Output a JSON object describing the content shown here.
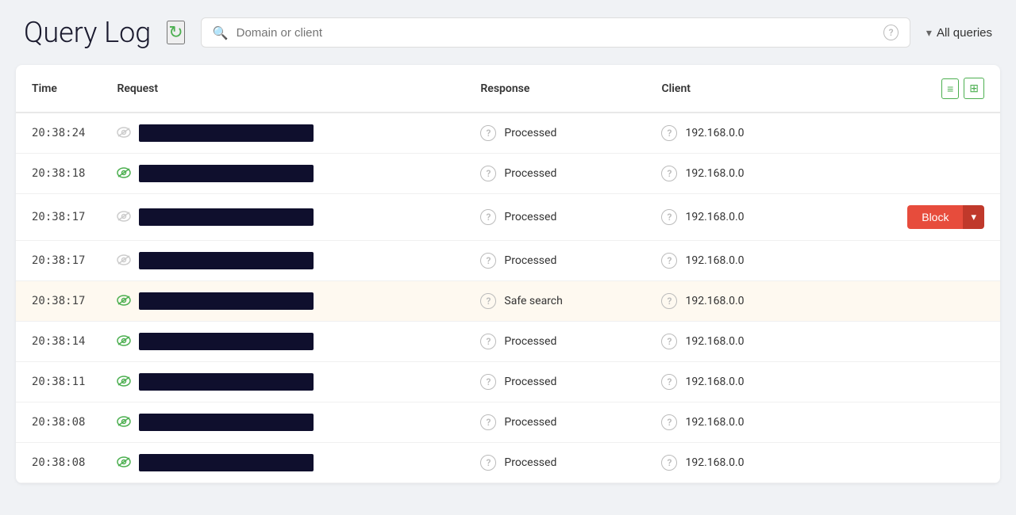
{
  "header": {
    "title": "Query Log",
    "refresh_label": "↻",
    "search_placeholder": "Domain or client",
    "filter_label": "All queries",
    "filter_chevron": "▾"
  },
  "table": {
    "columns": [
      "Time",
      "Request",
      "Response",
      "Client"
    ],
    "view_icon_list": "≡",
    "view_icon_grid": "⊞",
    "rows": [
      {
        "time": "20:38:24",
        "icon_color": "gray",
        "response": "Processed",
        "client": "192.168.0.0",
        "highlighted": false,
        "show_block": false
      },
      {
        "time": "20:38:18",
        "icon_color": "green",
        "response": "Processed",
        "client": "192.168.0.0",
        "highlighted": false,
        "show_block": false
      },
      {
        "time": "20:38:17",
        "icon_color": "gray",
        "response": "Processed",
        "client": "192.168.0.0",
        "highlighted": false,
        "show_block": true
      },
      {
        "time": "20:38:17",
        "icon_color": "gray",
        "response": "Processed",
        "client": "192.168.0.0",
        "highlighted": false,
        "show_block": false
      },
      {
        "time": "20:38:17",
        "icon_color": "green",
        "response": "Safe search",
        "client": "192.168.0.0",
        "highlighted": true,
        "show_block": false
      },
      {
        "time": "20:38:14",
        "icon_color": "green",
        "response": "Processed",
        "client": "192.168.0.0",
        "highlighted": false,
        "show_block": false
      },
      {
        "time": "20:38:11",
        "icon_color": "green",
        "response": "Processed",
        "client": "192.168.0.0",
        "highlighted": false,
        "show_block": false
      },
      {
        "time": "20:38:08",
        "icon_color": "green",
        "response": "Processed",
        "client": "192.168.0.0",
        "highlighted": false,
        "show_block": false
      },
      {
        "time": "20:38:08",
        "icon_color": "green",
        "response": "Processed",
        "client": "192.168.0.0",
        "highlighted": false,
        "show_block": false
      }
    ],
    "block_label": "Block",
    "block_chevron": "▾"
  }
}
